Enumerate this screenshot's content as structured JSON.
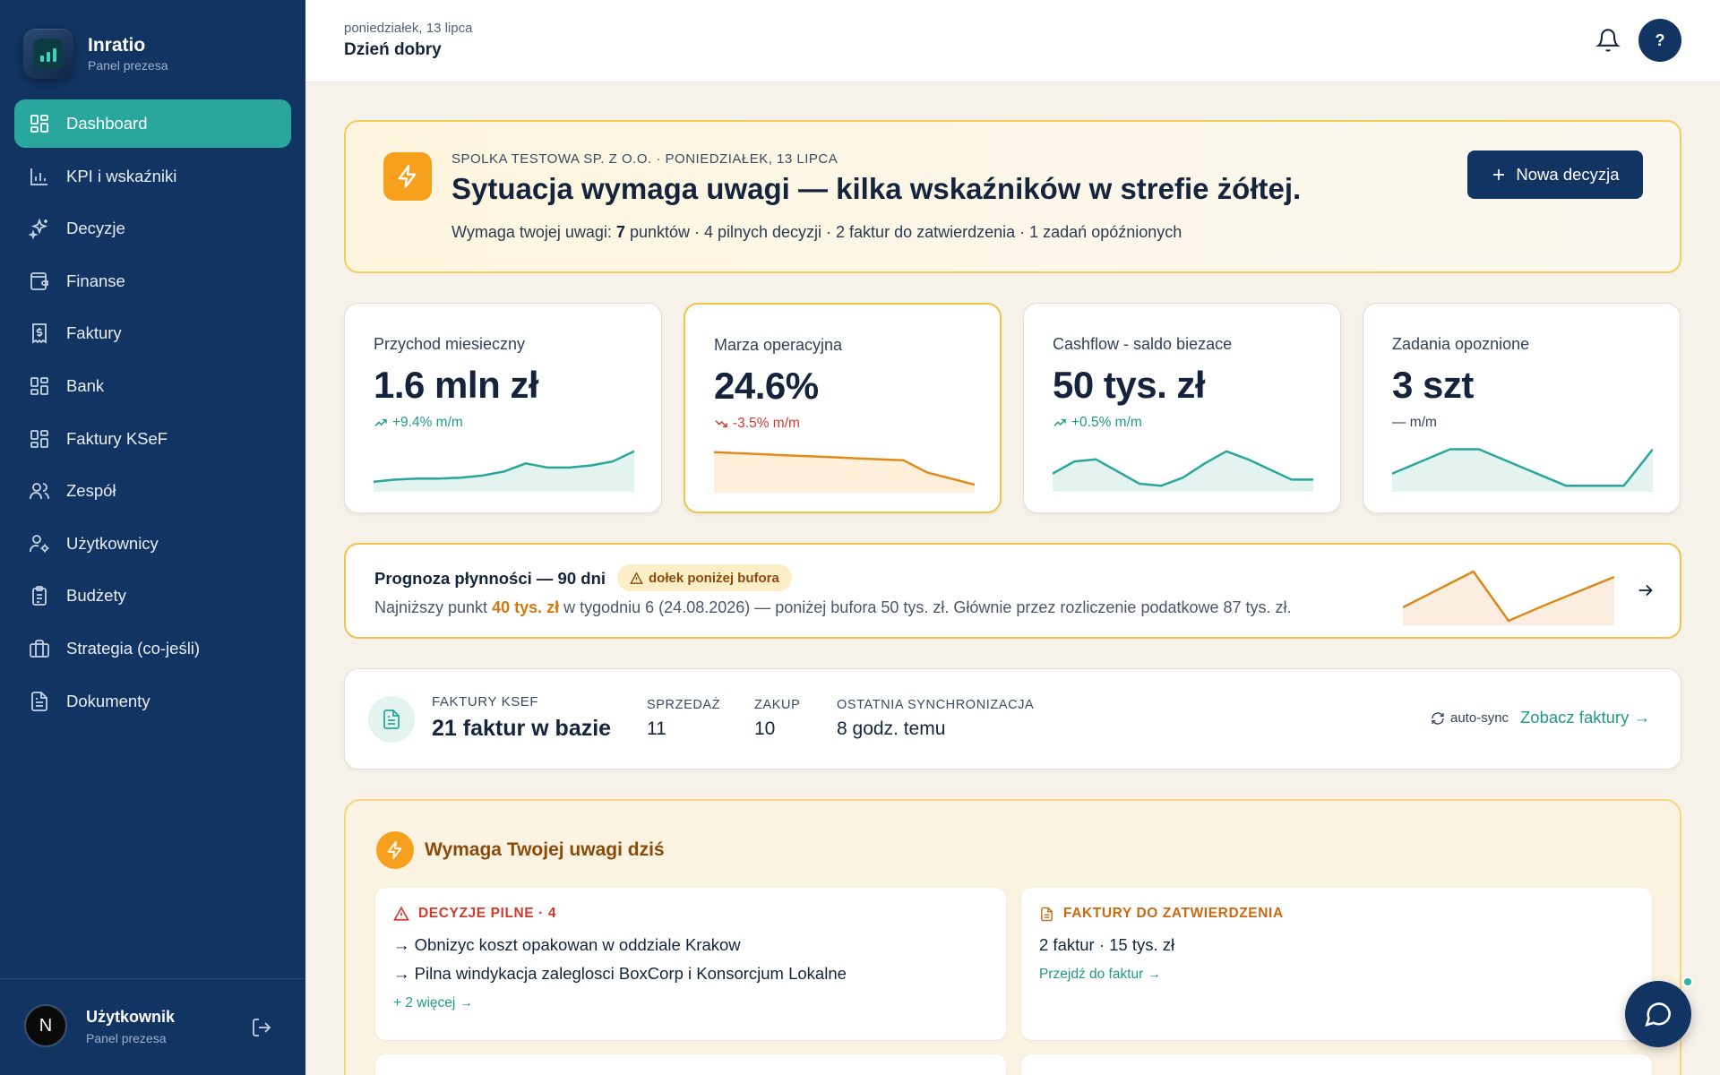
{
  "app": {
    "name": "Inratio",
    "subtitle": "Panel prezesa"
  },
  "sidebar": {
    "items": [
      {
        "label": "Dashboard",
        "icon": "dashboard-icon",
        "active": true
      },
      {
        "label": "KPI i wskaźniki",
        "icon": "bar-chart-icon"
      },
      {
        "label": "Decyzje",
        "icon": "sparkles-icon"
      },
      {
        "label": "Finanse",
        "icon": "wallet-icon"
      },
      {
        "label": "Faktury",
        "icon": "invoice-icon"
      },
      {
        "label": "Bank",
        "icon": "grid-icon"
      },
      {
        "label": "Faktury KSeF",
        "icon": "grid-icon"
      },
      {
        "label": "Zespół",
        "icon": "team-icon"
      },
      {
        "label": "Użytkownicy",
        "icon": "user-cog-icon"
      },
      {
        "label": "Budżety",
        "icon": "clipboard-icon"
      },
      {
        "label": "Strategia (co-jeśli)",
        "icon": "briefcase-icon"
      },
      {
        "label": "Dokumenty",
        "icon": "document-icon"
      }
    ],
    "user": {
      "initial": "N",
      "name": "Użytkownik",
      "role": "Panel prezesa"
    }
  },
  "header": {
    "date": "poniedziałek, 13 lipca",
    "greeting": "Dzień dobry",
    "help_label": "?"
  },
  "alert": {
    "overline": "SPOLKA TESTOWA SP. Z O.O. · PONIEDZIAŁEK, 13 LIPCA",
    "title": "Sytuacja wymaga uwagi — kilka wskaźników w strefie żółtej.",
    "desc_prefix": "Wymaga twojej uwagi: ",
    "desc_count": "7",
    "desc_suffix": " punktów · 4 pilnych decyzji · 2 faktur do zatwierdzenia · 1 zadań opóźnionych",
    "button_label": "Nowa decyzja"
  },
  "kpis": [
    {
      "label": "Przychod miesieczny",
      "value": "1.6 mln zł",
      "delta": "+9.4% m/m",
      "trend": "up",
      "spark": [
        10,
        12,
        13,
        13,
        14,
        16,
        20,
        28,
        24,
        24,
        26,
        30,
        40
      ],
      "color": "#2aa79d",
      "fill": "#e3f3ef"
    },
    {
      "label": "Marza operacyjna",
      "value": "24.6%",
      "delta": "-3.5% m/m",
      "trend": "down",
      "spark": [
        40,
        39,
        38,
        37,
        36,
        35,
        34,
        33,
        32,
        20,
        14,
        8
      ],
      "color": "#e08a19",
      "fill": "#fdefd9"
    },
    {
      "label": "Cashflow - saldo biezace",
      "value": "50 tys. zł",
      "delta": "+0.5% m/m",
      "trend": "up",
      "spark": [
        18,
        30,
        32,
        20,
        8,
        6,
        14,
        28,
        40,
        32,
        22,
        12,
        12
      ],
      "color": "#2aa79d",
      "fill": "#e3f3ef"
    },
    {
      "label": "Zadania opoznione",
      "value": "3 szt",
      "delta": "— m/m",
      "trend": "flat",
      "spark": [
        18,
        30,
        42,
        42,
        30,
        18,
        6,
        6,
        6,
        42
      ],
      "color": "#2aa79d",
      "fill": "#e3f3ef"
    }
  ],
  "forecast": {
    "title": "Prognoza płynności — 90 dni",
    "badge": "dołek poniżej bufora",
    "desc_prefix": "Najniższy punkt ",
    "desc_value": "40 tys. zł",
    "desc_suffix": " w tygodniu 6 (24.08.2026) — poniżej bufora 50 tys. zł. Głównie przez rozliczenie podatkowe 87 tys. zł.",
    "spark": [
      20,
      40,
      60,
      5,
      22,
      38,
      54
    ]
  },
  "ksef": {
    "overline": "FAKTURY KSEF",
    "main": "21 faktur w bazie",
    "stats": [
      {
        "label": "SPRZEDAŻ",
        "value": "11"
      },
      {
        "label": "ZAKUP",
        "value": "10"
      },
      {
        "label": "OSTATNIA SYNCHRONIZACJA",
        "value": "8 godz. temu"
      }
    ],
    "autosync": "auto-sync",
    "link": "Zobacz faktury →"
  },
  "today": {
    "title": "Wymaga Twojej uwagi dziś",
    "decisions": {
      "header": "DECYZJE PILNE · 4",
      "items": [
        "→ Obnizyc koszt opakowan w oddziale Krakow",
        "→ Pilna windykacja zaleglosci BoxCorp i Konsorcjum Lokalne"
      ],
      "more": "+ 2 więcej →"
    },
    "invoices": {
      "header": "FAKTURY DO ZATWIERDZENIA",
      "summary": "2 faktur · 15 tys. zł",
      "link": "Przejdź do faktur →"
    }
  },
  "colors": {
    "sidebar": "#123462",
    "accent": "#2aa79d",
    "warning": "#f6a01e",
    "danger": "#cf3b2c"
  }
}
